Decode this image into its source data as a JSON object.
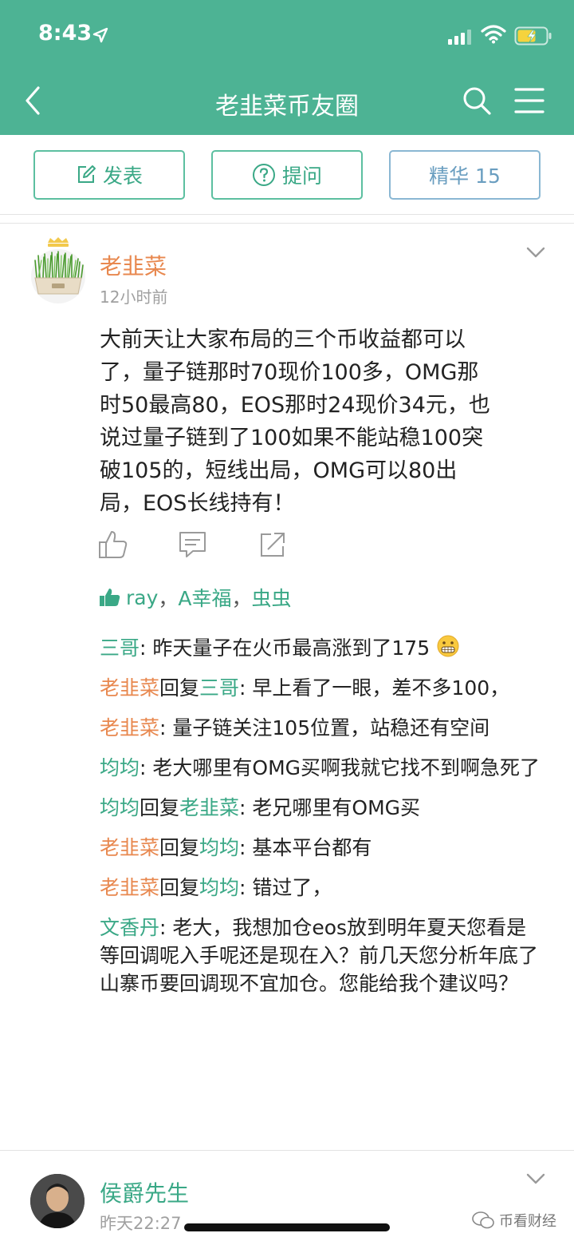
{
  "status_bar": {
    "time": "8:43"
  },
  "nav": {
    "title": "老韭菜币友圈"
  },
  "actions": {
    "post_label": "发表",
    "ask_label": "提问",
    "featured_label": "精华 15"
  },
  "post": {
    "author": "老韭菜",
    "time": "12小时前",
    "body": "大前天让大家布局的三个币收益都可以\n了，量子链那时70现价100多，OMG那\n时50最高80，EOS那时24现价34元，也\n说过量子链到了100如果不能站稳100突\n破105的，短线出局，OMG可以80出\n局，EOS长线持有！",
    "likes": [
      "ray",
      "A幸福",
      "虫虫"
    ],
    "like_sep": "，"
  },
  "comments": [
    {
      "name": "三哥",
      "name_color": "green",
      "text": ": 昨天量子在火币最高涨到了175",
      "emoji": "grimacing-face-icon"
    },
    {
      "name": "老韭菜",
      "name_color": "orange",
      "reply_word": "回复",
      "reply_to": "三哥",
      "reply_color": "green",
      "text": ": 早上看了一眼，差不多100，"
    },
    {
      "name": "老韭菜",
      "name_color": "orange",
      "text": ": 量子链关注105位置，站稳还有空间"
    },
    {
      "name": "均均",
      "name_color": "green",
      "text": ": 老大哪里有OMG买啊我就它找不到啊急死了"
    },
    {
      "name": "均均",
      "name_color": "green",
      "reply_word": "回复",
      "reply_to": "老韭菜",
      "reply_color": "green",
      "text": ": 老兄哪里有OMG买"
    },
    {
      "name": "老韭菜",
      "name_color": "orange",
      "reply_word": "回复",
      "reply_to": "均均",
      "reply_color": "green",
      "text": ": 基本平台都有"
    },
    {
      "name": "老韭菜",
      "name_color": "orange",
      "reply_word": "回复",
      "reply_to": "均均",
      "reply_color": "green",
      "text": ": 错过了，"
    },
    {
      "name": "文香丹",
      "name_color": "green",
      "text": ": 老大，我想加仓eos放到明年夏天您看是等回调呢入手呢还是现在入？前几天您分析年底了山寨币要回调现不宜加仓。您能给我个建议吗？"
    }
  ],
  "next_post": {
    "author": "侯爵先生",
    "time": "昨天22:27"
  },
  "watermark": {
    "text": "币看财经"
  },
  "colors": {
    "header": "#4db394",
    "orange_name": "#e8884f",
    "green_name": "#3aa886"
  }
}
